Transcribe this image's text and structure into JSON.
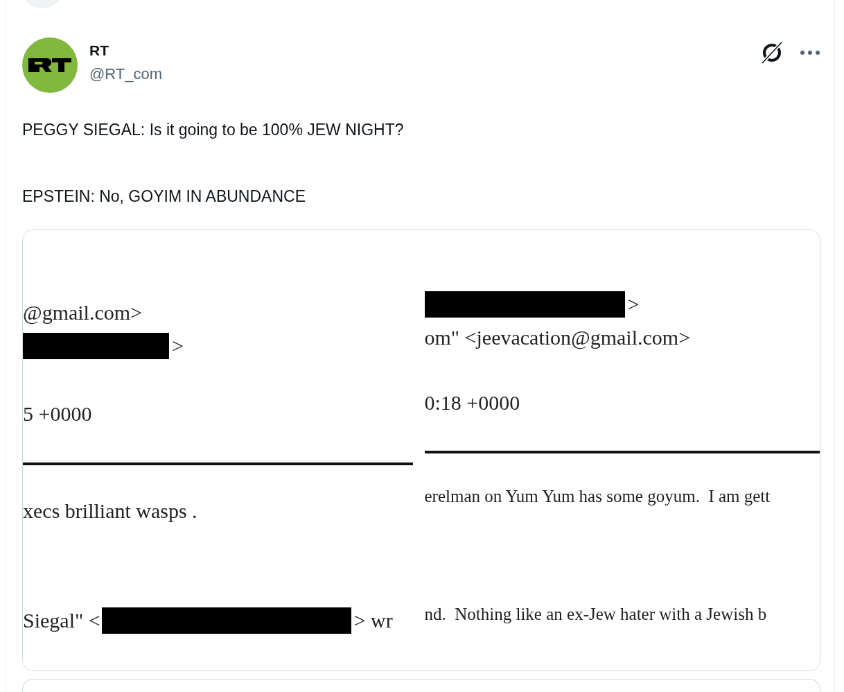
{
  "author": {
    "name": "RT",
    "handle": "@RT_com"
  },
  "text": [
    "PEGGY SIEGAL: Is it going to be 100% JEW NIGHT?",
    "EPSTEIN: No, GOYIM IN ABUNDANCE"
  ],
  "media": {
    "panels": [
      {
        "lines": [
          {
            "kind": "text",
            "segments": [
              {
                "kind": "text",
                "text": "@gmail.com>"
              }
            ]
          },
          {
            "kind": "text",
            "segments": [
              {
                "kind": "redaction"
              },
              {
                "kind": "text",
                "text": ">"
              }
            ]
          },
          {
            "kind": "text",
            "segments": [
              {
                "kind": "text",
                "text": "5 +0000"
              }
            ]
          },
          {
            "kind": "rule"
          },
          {
            "kind": "text",
            "segments": [
              {
                "kind": "text",
                "text": "xecs brilliant wasps ."
              }
            ]
          },
          {
            "kind": "text",
            "segments": [
              {
                "kind": "text",
                "text": "Siegal\" <"
              },
              {
                "kind": "redaction"
              },
              {
                "kind": "text",
                "text": "> wr"
              }
            ]
          }
        ]
      },
      {
        "lines": [
          {
            "kind": "text",
            "segments": [
              {
                "kind": "redaction"
              },
              {
                "kind": "text",
                "text": ">"
              }
            ]
          },
          {
            "kind": "text",
            "segments": [
              {
                "kind": "text",
                "text": "om\" <jeevacation@gmail.com>"
              }
            ]
          },
          {
            "kind": "text",
            "segments": [
              {
                "kind": "text",
                "text": "0:18 +0000"
              }
            ]
          },
          {
            "kind": "rule"
          },
          {
            "kind": "small",
            "segments": [
              {
                "kind": "text",
                "text": "erelman on Yum Yum has some goyum.  I am gett"
              }
            ]
          },
          {
            "kind": "small",
            "segments": [
              {
                "kind": "text",
                "text": "nd.  Nothing like an ex-Jew hater with a Jewish b"
              }
            ]
          }
        ]
      }
    ]
  }
}
